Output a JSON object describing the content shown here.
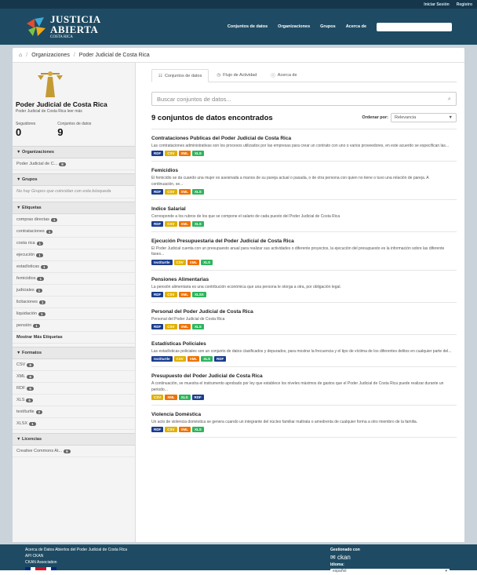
{
  "topbar": {
    "login": "Iniciar Sesión",
    "register": "Registro"
  },
  "logo": {
    "line1": "JUSTICIA",
    "line2": "ABIERTA",
    "line3": "COSTA RICA"
  },
  "nav": {
    "items": [
      "Conjuntos de datos",
      "Organizaciones",
      "Grupos",
      "Acerca de"
    ],
    "search_placeholder": "Búsqueda",
    "search_icon": "search-icon"
  },
  "breadcrumb": {
    "items": [
      "Organizaciones",
      "Poder Judicial de Costa Rica"
    ],
    "sep": "/",
    "home_icon": "home-icon"
  },
  "org": {
    "name": "Poder Judicial de Costa Rica",
    "desc": "Poder Judicial de Costa Rica leer más",
    "followers_label": "Seguidores",
    "followers": "0",
    "datasets_label": "Conjuntos de datos",
    "datasets": "9"
  },
  "facets": {
    "orgs": {
      "title": "Organizaciones",
      "items": [
        {
          "label": "Poder Judicial de C...",
          "count": "9"
        }
      ]
    },
    "groups": {
      "title": "Grupos",
      "empty": "No hay Grupos que coincidan con esta búsqueda"
    },
    "tags": {
      "title": "Etiquetas",
      "items": [
        {
          "label": "compras directas",
          "count": "1"
        },
        {
          "label": "contrataciones",
          "count": "1"
        },
        {
          "label": "costa rica",
          "count": "1"
        },
        {
          "label": "ejecución",
          "count": "1"
        },
        {
          "label": "estadísticas",
          "count": "1"
        },
        {
          "label": "femicidios",
          "count": "1"
        },
        {
          "label": "judiciales",
          "count": "1"
        },
        {
          "label": "licitaciones",
          "count": "1"
        },
        {
          "label": "liquidación",
          "count": "1"
        },
        {
          "label": "pensión",
          "count": "1"
        }
      ],
      "more": "Mostrar Más Etiquetas"
    },
    "formats": {
      "title": "Formatos",
      "items": [
        {
          "label": "CSV",
          "count": "8"
        },
        {
          "label": "XML",
          "count": "8"
        },
        {
          "label": "RDF",
          "count": "6"
        },
        {
          "label": "XLS",
          "count": "6"
        },
        {
          "label": "text/turtle",
          "count": "2"
        },
        {
          "label": "XLSX",
          "count": "1"
        }
      ]
    },
    "licenses": {
      "title": "Licencias",
      "items": [
        {
          "label": "Creative Commons At...",
          "count": "9"
        }
      ]
    }
  },
  "tabs": [
    "Conjuntos de datos",
    "Flujo de Actividad",
    "Acerca de"
  ],
  "search": {
    "placeholder": "Buscar conjuntos de datos..."
  },
  "results": {
    "heading": "9 conjuntos de datos encontrados",
    "sort_label": "Ordenar por:",
    "sort_value": "Relevancia"
  },
  "format_colors": {
    "RDF": "#1a3d8f",
    "CSV": "#dfb100",
    "XML": "#ef7100",
    "XLS": "#2db55d",
    "XLSX": "#2db55d",
    "text/turtle": "#1a3d8f"
  },
  "datasets": [
    {
      "title": "Contrataciones Publicas del Poder Judicial de Costa Rica",
      "desc": "Las contrataciones administrativas son los procesos utilizados por las empresas para crear un contrato con uno o varios proveedores, en este acuerdo se especifican las...",
      "formats": [
        "RDF",
        "CSV",
        "XML",
        "XLS"
      ]
    },
    {
      "title": "Femicidios",
      "desc": "El femicidio se da cuando una mujer es asesinada a manos de su pareja actual o pasada, o de otra persona con quien no tiene o tuvo una relación de pareja. A continuación, se...",
      "formats": [
        "RDF",
        "CSV",
        "XML",
        "XLS"
      ]
    },
    {
      "title": "Indice Salarial",
      "desc": "Corresponde a los rubros de los que se compone el salario de cada puesto del Poder Judicial de Costa Rica",
      "formats": [
        "RDF",
        "CSV",
        "XML",
        "XLS"
      ]
    },
    {
      "title": "Ejecución Presupuestaria del Poder Judicial de Costa Rica",
      "desc": "El Poder Judicial cuenta con un presupuesto anual para realizar sus actividades o diferente proyectos, la ejecución del presupuesto es la información sobre las diferente fases...",
      "formats": [
        "text/turtle",
        "CSV",
        "XML",
        "XLS"
      ]
    },
    {
      "title": "Pensiones Alimentarias",
      "desc": "La pensión alimentaria es una contribución económica que una persona le otorga a otra, por obligación legal.",
      "formats": [
        "RDF",
        "CSV",
        "XML",
        "XLSX"
      ]
    },
    {
      "title": "Personal del Poder Judicial de Costa Rica",
      "desc": "Personal del Poder Judicial de Costa Rica",
      "formats": [
        "RDF",
        "CSV",
        "XML",
        "XLS"
      ]
    },
    {
      "title": "Estadísticas Policiales",
      "desc": "Las estadísticas policiales son un conjunto de datos clasificados y depurados, para mostrar la frecuencia y el tipo de víctima de los diferentes delitos en cualquier parte del...",
      "formats": [
        "text/turtle",
        "CSV",
        "XML",
        "XLS",
        "RDF"
      ]
    },
    {
      "title": "Presupuesto del Poder Judicial de Costa Rica",
      "desc": "A continuación, se muestra el instrumento aprobado por ley que establece los niveles máximos de gastos que el Poder Judicial de Costa Rica puede realizar durante un periodo...",
      "formats": [
        "CSV",
        "XML",
        "XLS",
        "RDF"
      ]
    },
    {
      "title": "Violencia Doméstica",
      "desc": "Un acto de violencia doméstica se genera cuando un integrante del núcleo familiar maltrata o amedrenta de cualquier forma a otro miembro de la familia.",
      "formats": [
        "RDF",
        "CSV",
        "XML",
        "XLS"
      ]
    }
  ],
  "footer": {
    "links": [
      "Acerca de Datos Abiertos del Poder Judicial de Costa Rica",
      "API CKAN",
      "CKAN Association"
    ],
    "managed": "Gestionado con",
    "ckan": "ckan",
    "lang_label": "Idioma:",
    "lang_value": "español"
  }
}
